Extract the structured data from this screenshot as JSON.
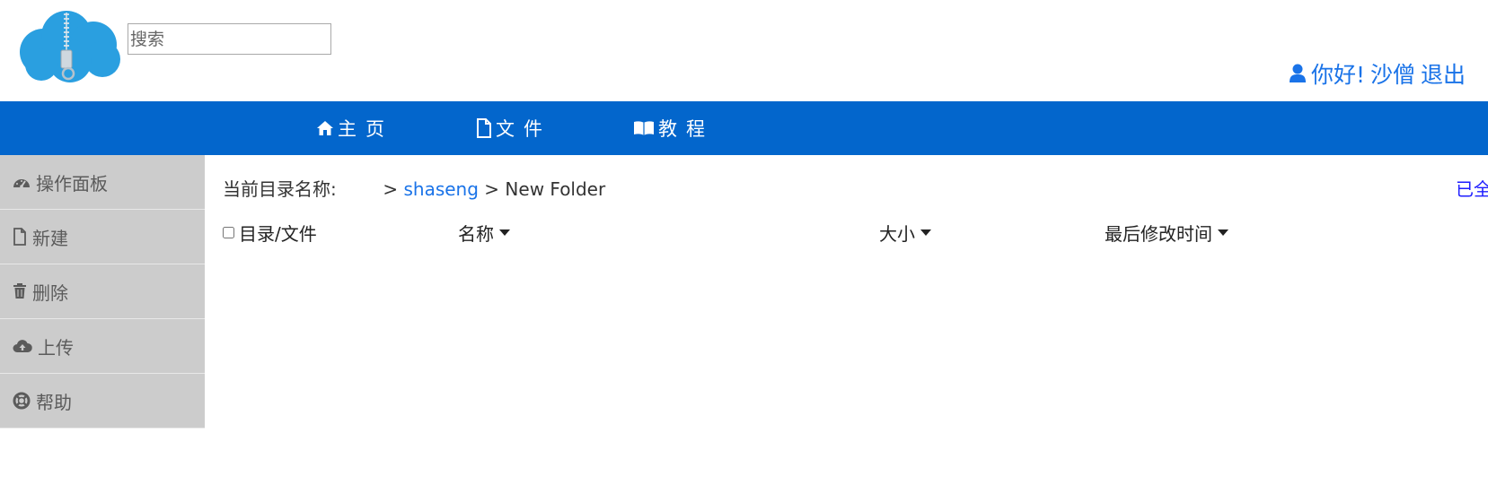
{
  "header": {
    "search": {
      "placeholder": "搜索",
      "value": ""
    },
    "user": {
      "greeting": "你好!",
      "username": "沙僧",
      "logout_label": "退出"
    }
  },
  "topnav": {
    "items": [
      {
        "label": "主页",
        "icon": "home-icon"
      },
      {
        "label": "文件",
        "icon": "file-icon"
      },
      {
        "label": "教程",
        "icon": "book-icon"
      }
    ]
  },
  "sidebar": {
    "items": [
      {
        "label": "操作面板",
        "icon": "dashboard-icon"
      },
      {
        "label": "新建",
        "icon": "new-file-icon"
      },
      {
        "label": "删除",
        "icon": "trash-icon"
      },
      {
        "label": "上传",
        "icon": "cloud-upload-icon"
      },
      {
        "label": "帮助",
        "icon": "lifebuoy-icon"
      }
    ]
  },
  "breadcrumb": {
    "label": "当前目录名称:",
    "separator": ">",
    "path": [
      "shaseng",
      "New Folder"
    ]
  },
  "capacity_text": "已全",
  "table": {
    "columns": [
      "目录/文件",
      "名称",
      "大小",
      "最后修改时间"
    ],
    "rows": []
  },
  "colors": {
    "nav_bg": "#0366cc",
    "sidebar_bg": "#cccccc",
    "link": "#1a73e8",
    "capacity": "#1d1dff"
  }
}
